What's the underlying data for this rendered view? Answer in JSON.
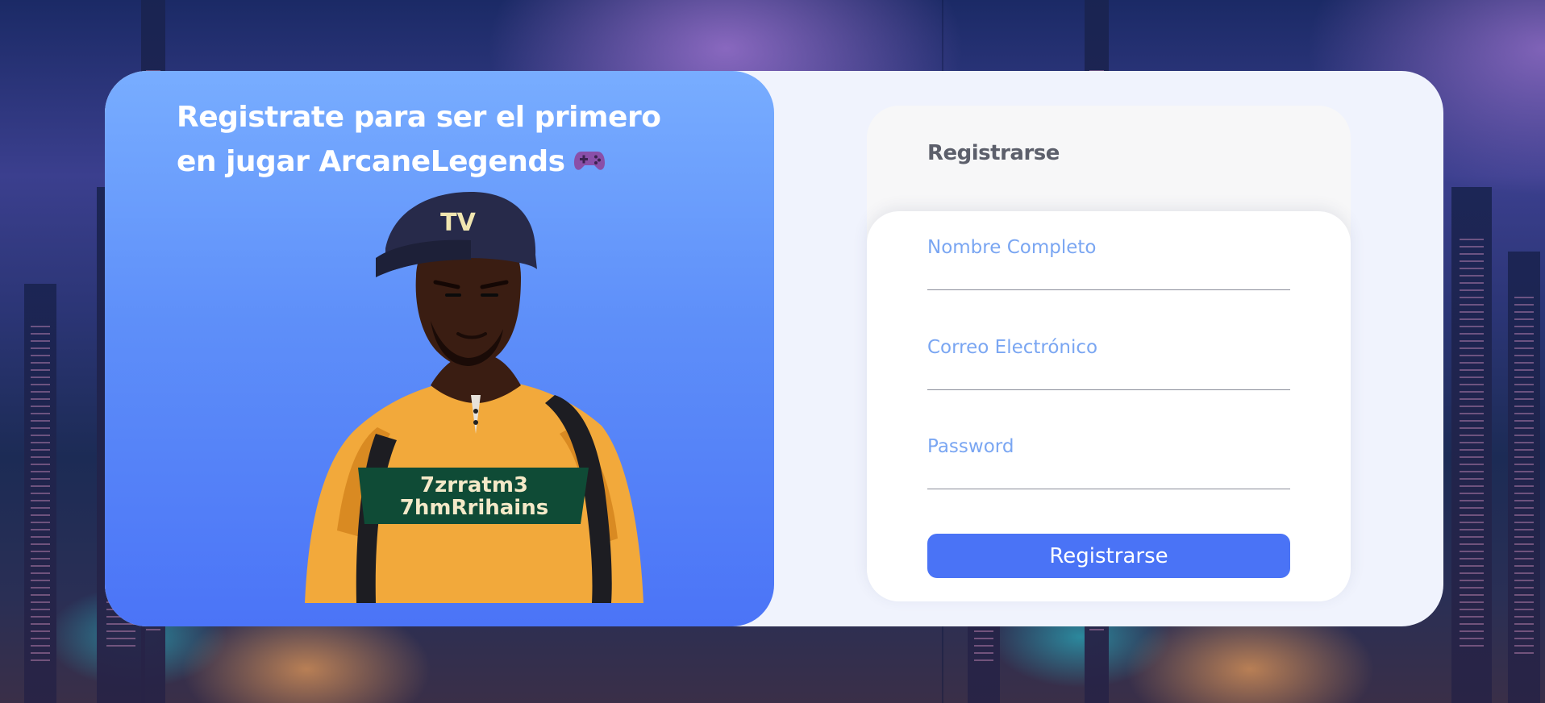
{
  "hero": {
    "title": "Registrate para ser el primero en jugar ArcaneLegends",
    "emoji": "🎮"
  },
  "form": {
    "header": "Registrarse",
    "fields": [
      {
        "placeholder": "Nombre Completo",
        "value": ""
      },
      {
        "placeholder": "Correo Electrónico",
        "value": ""
      },
      {
        "placeholder": "Password",
        "value": ""
      }
    ],
    "submit_label": "Registrarse"
  },
  "colors": {
    "accent": "#4a73f6",
    "hero_top": "#78adff",
    "hero_bottom": "#4b74f7",
    "placeholder": "#7aa6f2",
    "card_bg": "#f0f3fd"
  },
  "icons": {
    "gamepad": "gamepad-icon"
  }
}
